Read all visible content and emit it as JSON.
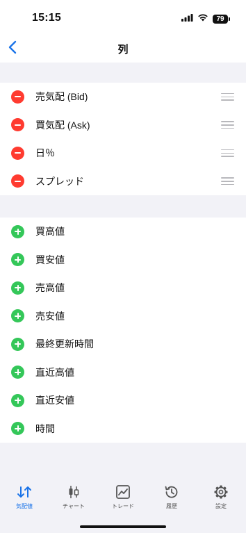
{
  "status_bar": {
    "time": "15:15",
    "battery": "79"
  },
  "nav": {
    "title": "列"
  },
  "selected_columns": [
    {
      "label": "売気配 (Bid)"
    },
    {
      "label": "買気配 (Ask)"
    },
    {
      "label": "日％"
    },
    {
      "label": "スプレッド"
    }
  ],
  "available_columns": [
    {
      "label": "買高値"
    },
    {
      "label": "買安値"
    },
    {
      "label": "売高値"
    },
    {
      "label": "売安値"
    },
    {
      "label": "最終更新時間"
    },
    {
      "label": "直近高値"
    },
    {
      "label": "直近安値"
    },
    {
      "label": "時間"
    }
  ],
  "tabs": [
    {
      "label": "気配値",
      "icon": "quotes-icon",
      "active": true
    },
    {
      "label": "チャート",
      "icon": "chart-icon",
      "active": false
    },
    {
      "label": "トレード",
      "icon": "trade-icon",
      "active": false
    },
    {
      "label": "履歴",
      "icon": "history-icon",
      "active": false
    },
    {
      "label": "設定",
      "icon": "settings-icon",
      "active": false
    }
  ],
  "colors": {
    "accent": "#1a73e8",
    "remove": "#ff3b30",
    "add": "#34c759",
    "background": "#f2f2f7"
  }
}
